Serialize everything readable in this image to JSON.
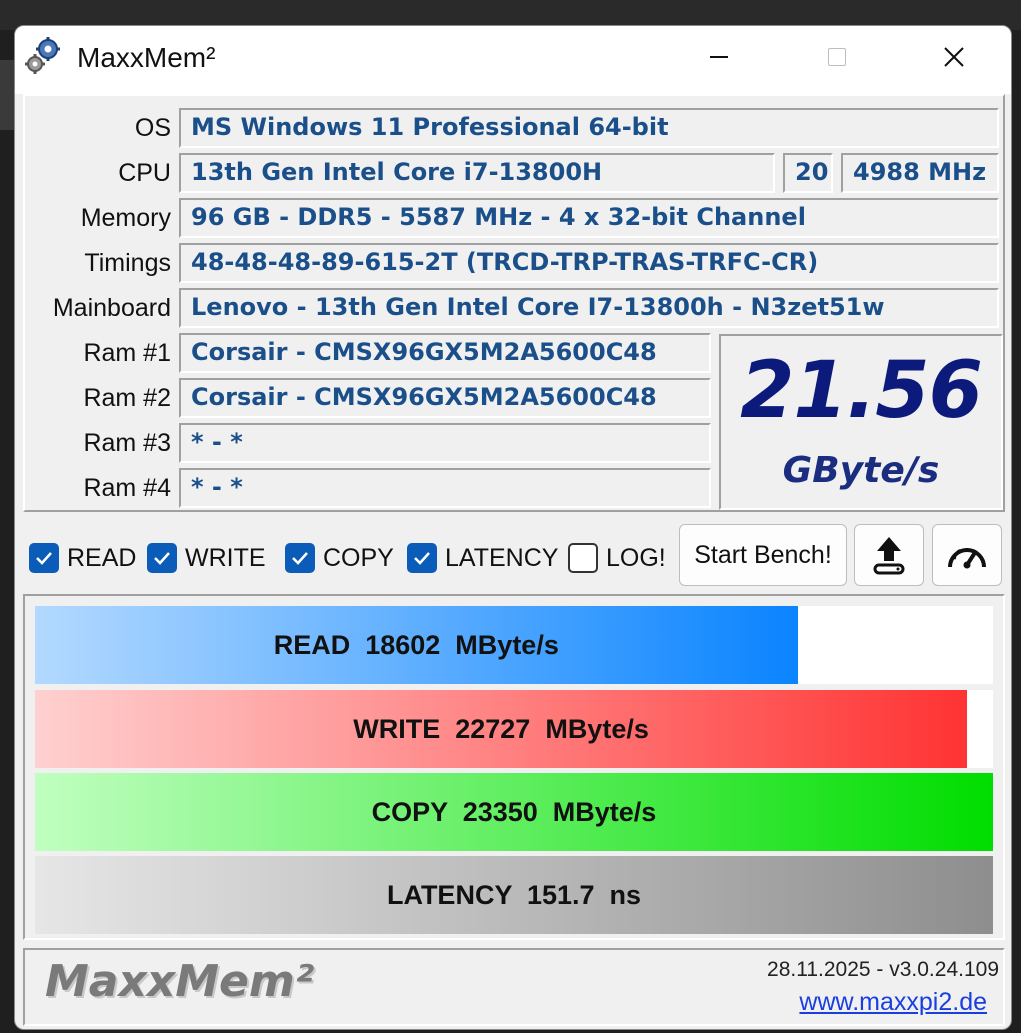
{
  "window": {
    "title": "MaxxMem²"
  },
  "system": {
    "os_label": "OS",
    "os": "MS Windows 11 Professional 64-bit",
    "cpu_label": "CPU",
    "cpu": "13th Gen Intel Core i7-13800H",
    "cpu_threads": "20",
    "cpu_clock": "4988 MHz",
    "memory_label": "Memory",
    "memory": "96 GB - DDR5 - 5587 MHz - 4 x 32-bit Channel",
    "timings_label": "Timings",
    "timings": "48-48-48-89-615-2T (TRCD-TRP-TRAS-TRFC-CR)",
    "mainboard_label": "Mainboard",
    "mainboard": "Lenovo - 13th Gen Intel Core I7-13800h - N3zet51w",
    "ram": [
      {
        "label": "Ram #1",
        "value": "Corsair - CMSX96GX5M2A5600C48"
      },
      {
        "label": "Ram #2",
        "value": "Corsair - CMSX96GX5M2A5600C48"
      },
      {
        "label": "Ram #3",
        "value": "* - *"
      },
      {
        "label": "Ram #4",
        "value": "* - *"
      }
    ]
  },
  "score": {
    "value": "21.56",
    "unit": "GByte/s"
  },
  "options": {
    "read": {
      "label": "READ",
      "checked": true
    },
    "write": {
      "label": "WRITE",
      "checked": true
    },
    "copy": {
      "label": "COPY",
      "checked": true
    },
    "latency": {
      "label": "LATENCY",
      "checked": true
    },
    "log": {
      "label": "LOG!",
      "checked": false
    }
  },
  "buttons": {
    "start": "Start Bench!",
    "upload_icon": "upload-icon",
    "speed_icon": "speedometer-icon"
  },
  "results": [
    {
      "text": "READ  18602  MByte/s",
      "fill": 0.796,
      "from": "#b3d9ff",
      "to": "#0a84ff"
    },
    {
      "text": "WRITE  22727  MByte/s",
      "fill": 0.973,
      "from": "#ffd0d0",
      "to": "#ff3333"
    },
    {
      "text": "COPY  23350  MByte/s",
      "fill": 1.0,
      "from": "#c0ffc0",
      "to": "#00dd00"
    },
    {
      "text": "LATENCY  151.7  ns",
      "fill": 1.0,
      "from": "#e6e6e6",
      "to": "#8e8e8e"
    }
  ],
  "footer": {
    "logo": "MaxxMem²",
    "version": "28.11.2025 - v3.0.24.109",
    "link": "www.maxxpi2.de"
  }
}
